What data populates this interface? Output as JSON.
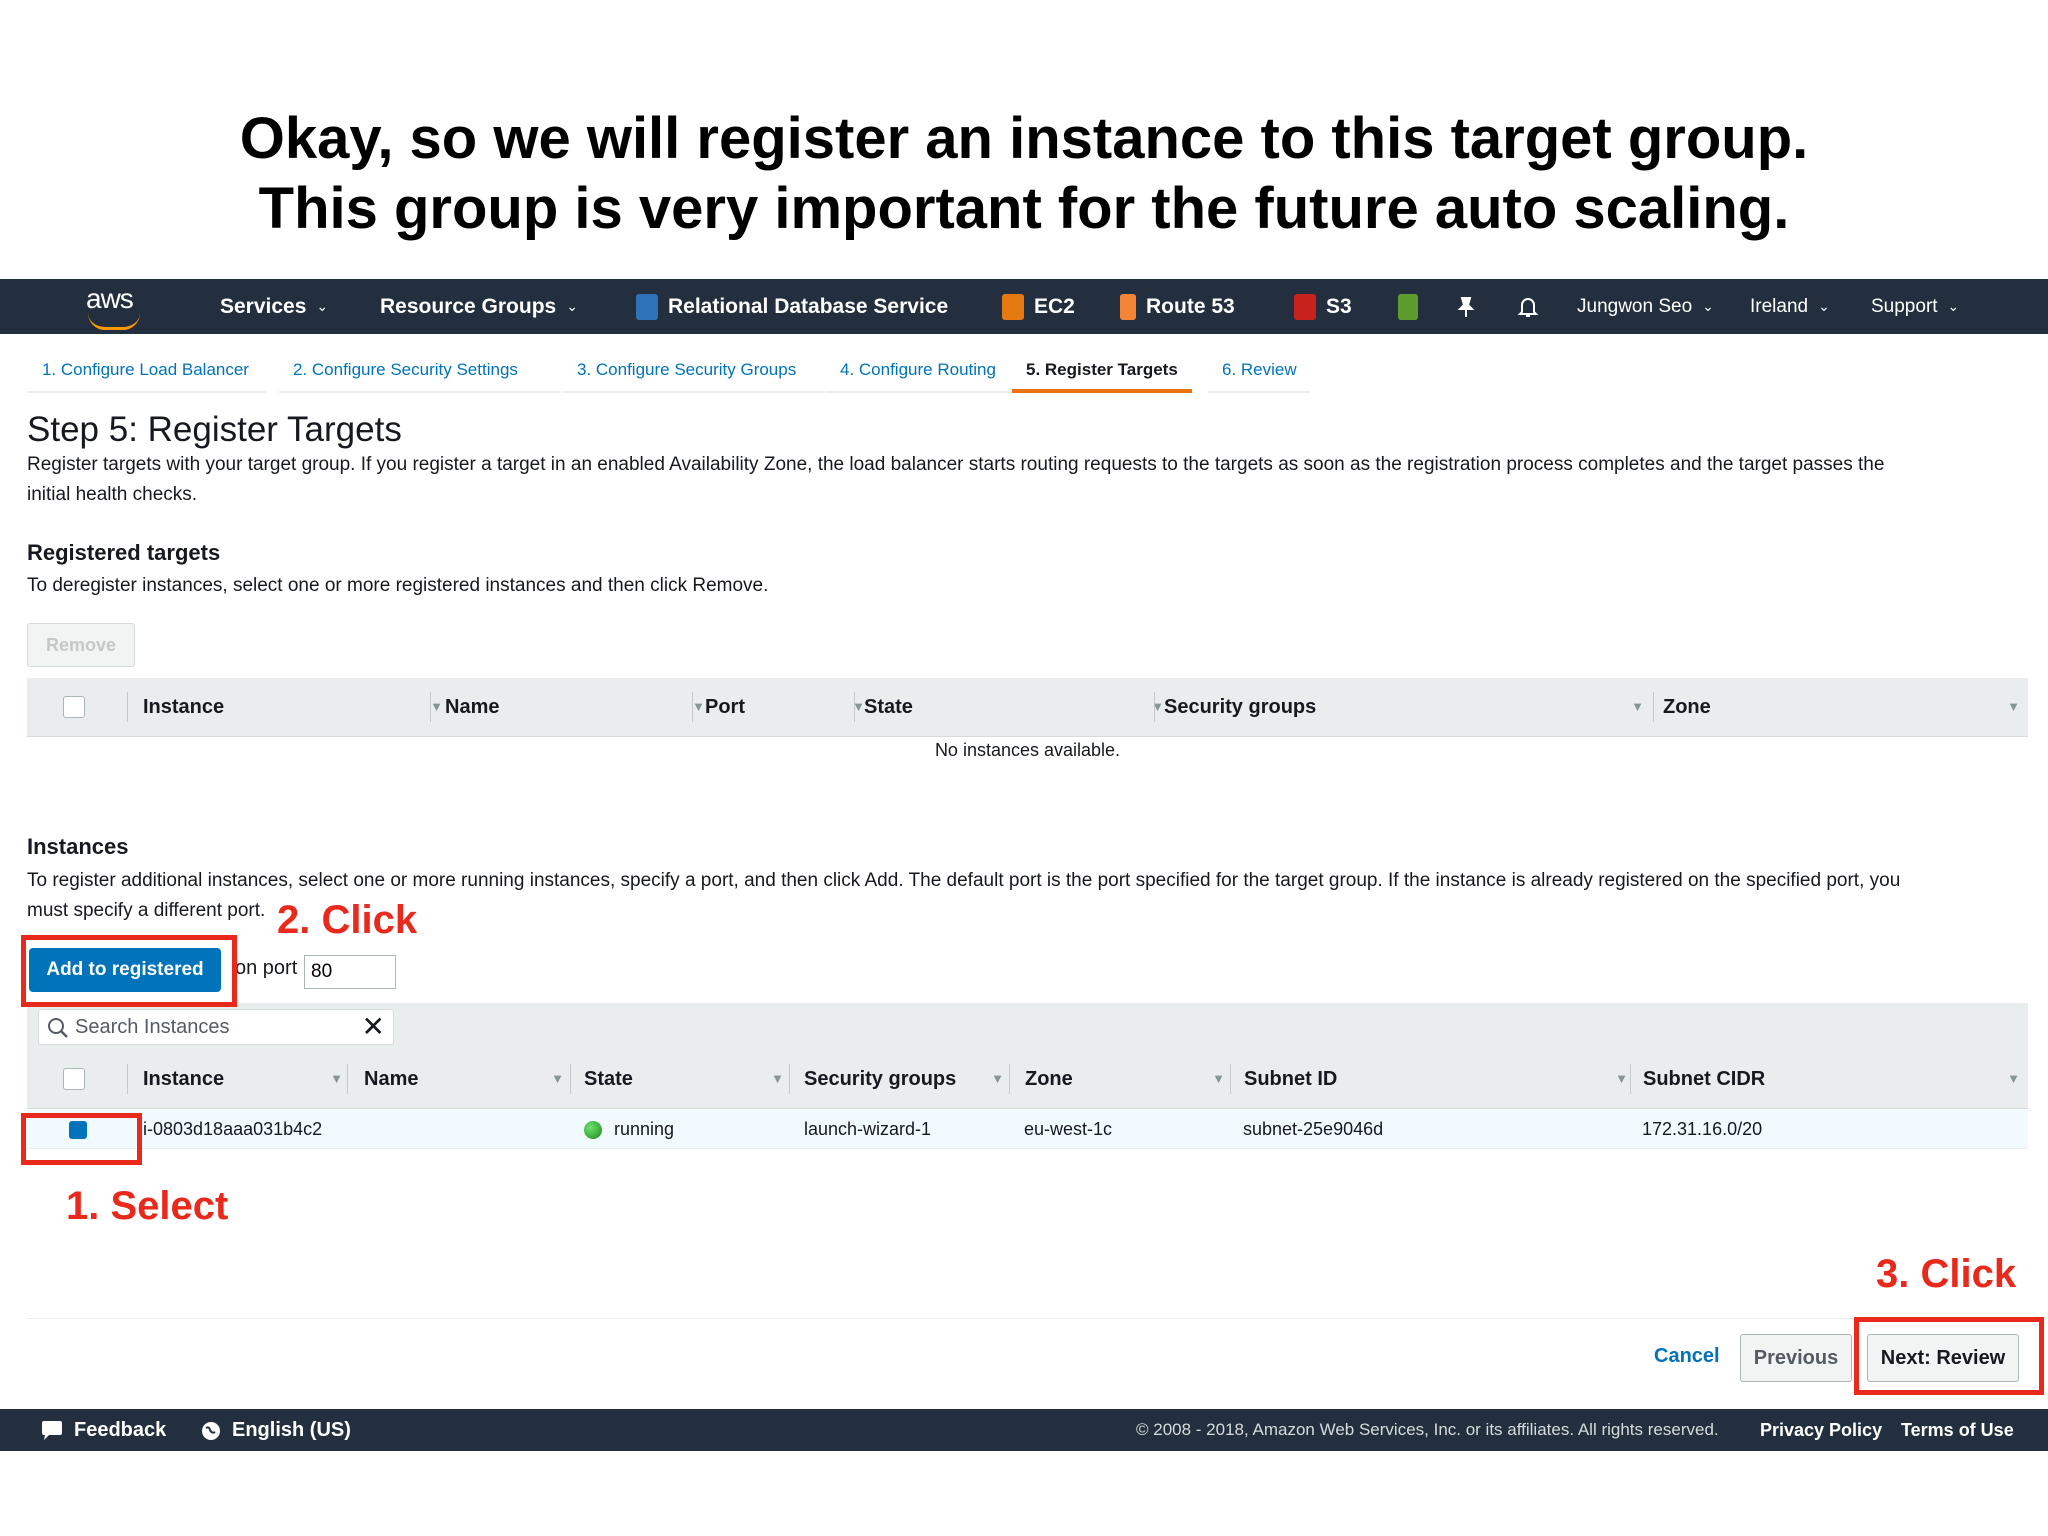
{
  "caption": {
    "line1": "Okay, so we will register an instance to this target group.",
    "line2": "This group is very important for the future auto scaling."
  },
  "topnav": {
    "logo": "aws",
    "services": "Services",
    "resource_groups": "Resource Groups",
    "rds": "Relational Database Service",
    "ec2": "EC2",
    "route53": "Route 53",
    "s3": "S3",
    "user": "Jungwon Seo",
    "region": "Ireland",
    "support": "Support",
    "chevron": "⌄"
  },
  "tabs": [
    {
      "label": "1. Configure Load Balancer"
    },
    {
      "label": "2. Configure Security Settings"
    },
    {
      "label": "3. Configure Security Groups"
    },
    {
      "label": "4. Configure Routing"
    },
    {
      "label": "5. Register Targets"
    },
    {
      "label": "6. Review"
    }
  ],
  "page": {
    "title": "Step 5: Register Targets",
    "description_l1": "Register targets with your target group. If you register a target in an enabled Availability Zone, the load balancer starts routing requests to the targets as soon as the registration process completes and the target passes the",
    "description_l2": "initial health checks."
  },
  "registered": {
    "heading": "Registered targets",
    "help": "To deregister instances, select one or more registered instances and then click Remove.",
    "remove_label": "Remove",
    "columns": [
      "Instance",
      "Name",
      "Port",
      "State",
      "Security groups",
      "Zone"
    ],
    "empty_text": "No instances available."
  },
  "instances": {
    "heading": "Instances",
    "help_l1": "To register additional instances, select one or more running instances, specify a port, and then click Add. The default port is the port specified for the target group. If the instance is already registered on the specified port, you",
    "help_l2": "must specify a different port.",
    "add_label": "Add to registered",
    "on_port_label": "on port",
    "port_value": "80",
    "search_placeholder": "Search Instances",
    "clear_glyph": "✕",
    "columns": [
      "Instance",
      "Name",
      "State",
      "Security groups",
      "Zone",
      "Subnet ID",
      "Subnet CIDR"
    ],
    "rows": [
      {
        "instance": "i-0803d18aaa031b4c2",
        "name": "",
        "state": "running",
        "security_groups": "launch-wizard-1",
        "zone": "eu-west-1c",
        "subnet_id": "subnet-25e9046d",
        "subnet_cidr": "172.31.16.0/20",
        "selected": true
      }
    ]
  },
  "actions": {
    "cancel": "Cancel",
    "previous": "Previous",
    "next": "Next: Review"
  },
  "footer": {
    "feedback": "Feedback",
    "language": "English (US)",
    "copyright": "© 2008 - 2018, Amazon Web Services, Inc. or its affiliates. All rights reserved.",
    "privacy": "Privacy Policy",
    "terms": "Terms of Use"
  },
  "annotations": {
    "select": "1. Select",
    "click_add": "2. Click",
    "click_next": "3. Click"
  },
  "colors": {
    "nav_bg": "#232f3e",
    "primary": "#0073bb",
    "accent": "#ec7211",
    "annotation_red": "#e8291b",
    "running_green": "#1d8102"
  }
}
